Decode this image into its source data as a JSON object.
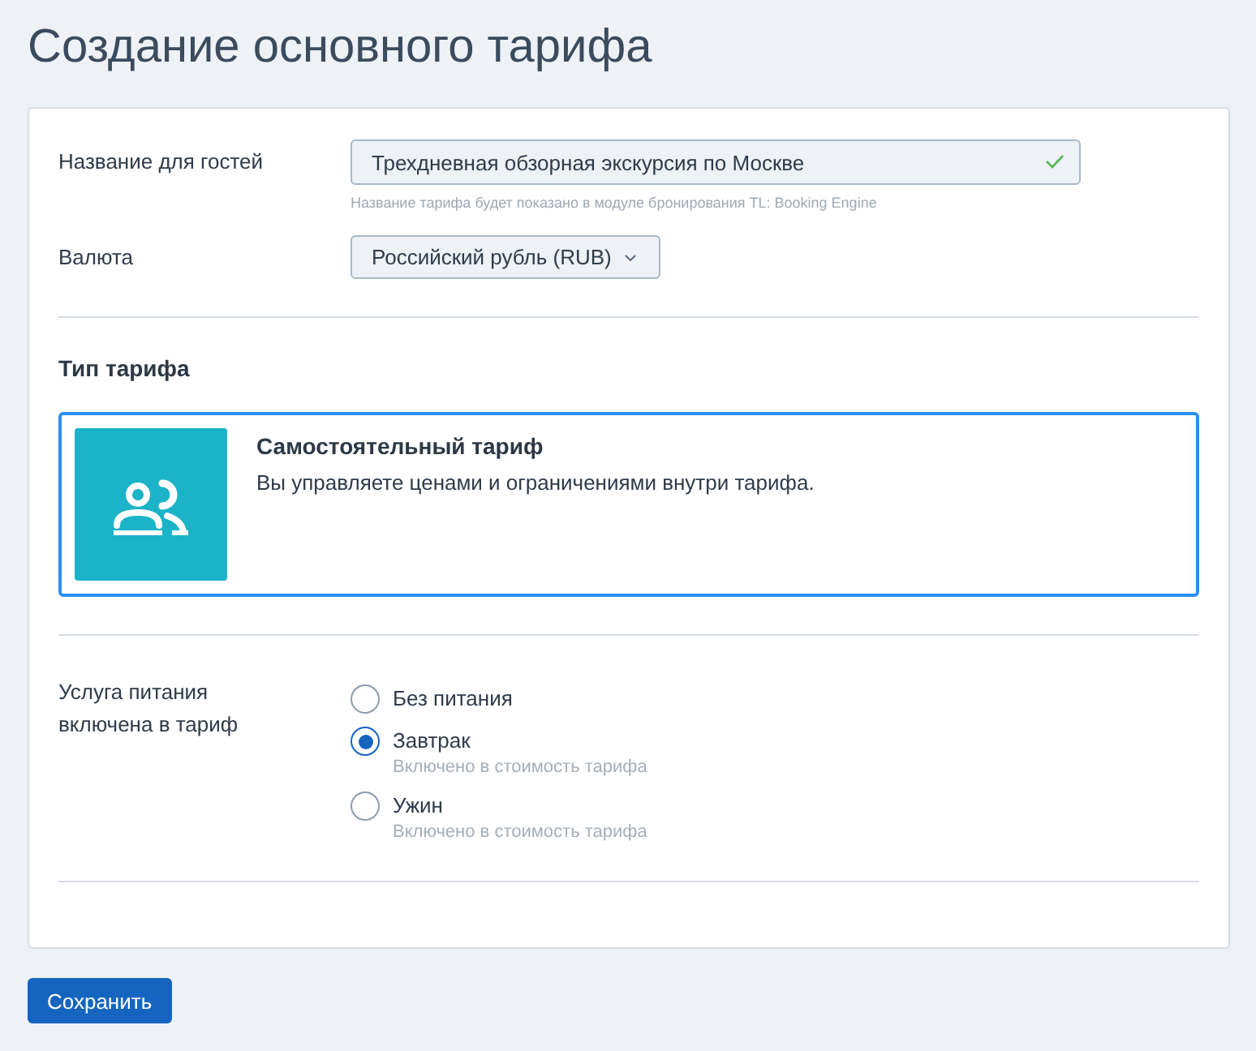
{
  "page": {
    "title": "Создание основного тарифа"
  },
  "form": {
    "fields": [
      {
        "kind": "text",
        "label": "Название для гостей",
        "value": "Трехдневная обзорная экскурсия по Москве",
        "valid": true,
        "hint": "Название тарифа будет показано в модуле бронирования TL: Booking Engine"
      },
      {
        "kind": "select",
        "label": "Валюта",
        "value": "Российский рубль (RUB)"
      }
    ]
  },
  "tariff_type": {
    "heading": "Тип тарифа",
    "options": [
      {
        "title": "Самостоятельный тариф",
        "description": "Вы управляете ценами и ограничениями внутри тарифа.",
        "selected": true
      }
    ]
  },
  "meals": {
    "label": "Услуга питания включена в тариф",
    "options": [
      {
        "label": "Без питания",
        "selected": false
      },
      {
        "label": "Завтрак",
        "note": "Включено в стоимость тарифа",
        "selected": true
      },
      {
        "label": "Ужин",
        "note": "Включено в стоимость тарифа",
        "selected": false
      }
    ]
  },
  "buttons": [
    {
      "label": "Сохранить"
    }
  ]
}
